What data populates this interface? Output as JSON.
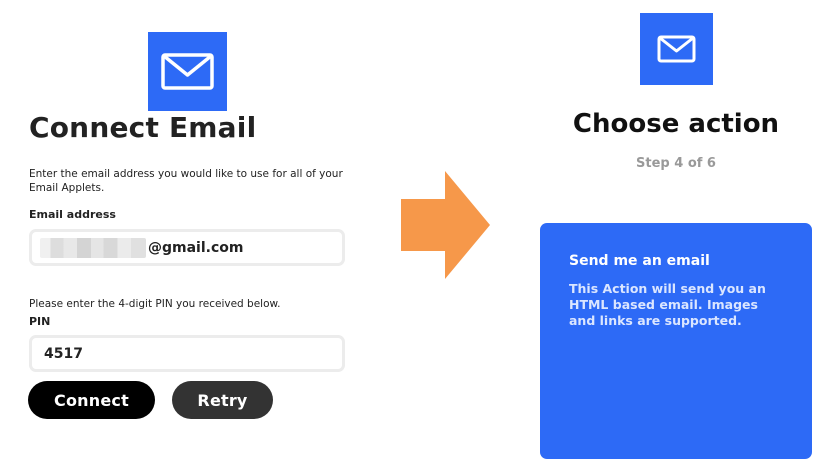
{
  "colors": {
    "email_brand_blue": "#2d6af6",
    "arrow_orange": "#f6984a",
    "connect_button": "#000000",
    "retry_button": "#333333",
    "step_gray": "#999999"
  },
  "connect_panel": {
    "logo_icon": "envelope-icon",
    "title": "Connect Email",
    "description": "Enter the email address you would like to use for all of your Email Applets.",
    "email_label": "Email address",
    "email_value_suffix": "@gmail.com",
    "pin_instructions": "Please enter the 4-digit PIN you received below.",
    "pin_label": "PIN",
    "pin_value": "4517",
    "connect_label": "Connect",
    "retry_label": "Retry"
  },
  "transition": {
    "icon": "right-arrow-icon"
  },
  "action_panel": {
    "logo_icon": "envelope-icon",
    "title": "Choose action",
    "step": "Step 4 of 6",
    "card_title": "Send me an email",
    "card_description": "This Action will send you an HTML based email. Images and links are supported."
  }
}
